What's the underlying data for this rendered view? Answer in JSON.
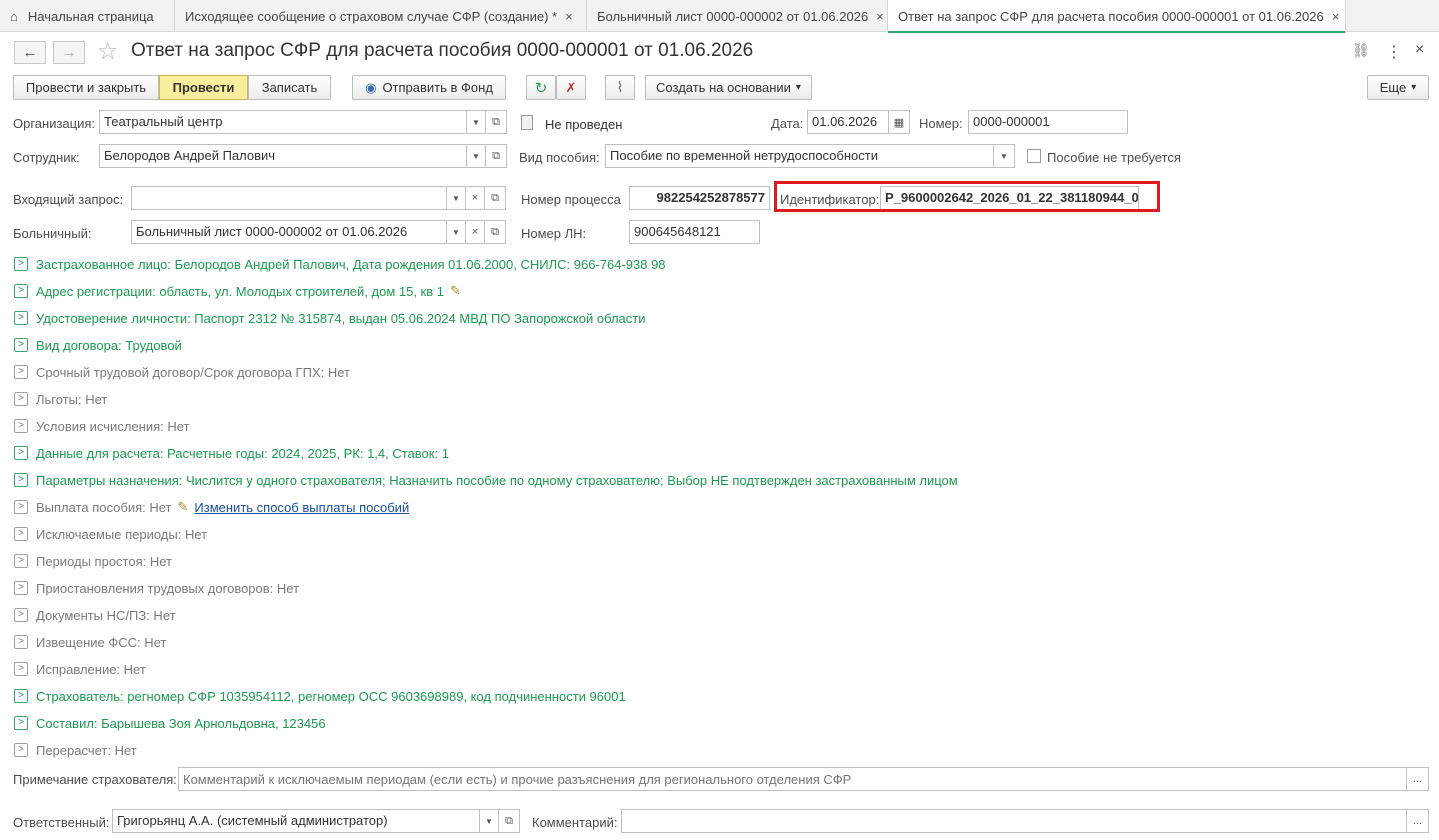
{
  "tabs": [
    {
      "label": "Начальная страница",
      "icon": "home-icon"
    },
    {
      "label": "Исходящее сообщение о страховом случае СФР (создание) *",
      "close": "×"
    },
    {
      "label": "Больничный лист 0000-000002 от 01.06.2026",
      "close": "×"
    },
    {
      "label": "Ответ на запрос СФР для расчета пособия 0000-000001 от 01.06.2026",
      "close": "×"
    }
  ],
  "window": {
    "title": "Ответ на запрос СФР для расчета пособия 0000-000001 от 01.06.2026",
    "back": "←",
    "forward": "→",
    "star": "☆",
    "link": "🔗",
    "more": "⋮",
    "close": "×"
  },
  "toolbar": {
    "post_close": "Провести и закрыть",
    "post": "Провести",
    "save": "Записать",
    "send_fund": "Отправить в Фонд",
    "create_based": "Создать на основании",
    "more": "Еще",
    "arrow": "▾"
  },
  "form": {
    "org_label": "Организация:",
    "org_value": "Театральный центр",
    "status": "Не проведен",
    "date_label": "Дата:",
    "date_value": "01.06.2026",
    "number_label": "Номер:",
    "number_value": "0000-000001",
    "employee_label": "Сотрудник:",
    "employee_value": "Белородов Андрей Палович",
    "benefit_type_label": "Вид пособия:",
    "benefit_type_value": "Пособие по временной нетрудоспособности",
    "not_required_label": "Пособие не требуется",
    "incoming_label": "Входящий запрос:",
    "incoming_value": "",
    "process_label": "Номер процесса",
    "process_value": "982254252878577",
    "id_label": "Идентификатор:",
    "id_value": "P_9600002642_2026_01_22_381180944_0:",
    "sick_label": "Больничный:",
    "sick_value": "Больничный лист 0000-000002 от 01.06.2026",
    "ln_label": "Номер ЛН:",
    "ln_value": "900645648121"
  },
  "sections": [
    {
      "text": "Застрахованное лицо: Белородов Андрей Палович, Дата рождения 01.06.2000, СНИЛС: 966-764-938 98",
      "state": "green"
    },
    {
      "text": "Адрес регистрации: область, ул. Молодых строителей, дом 15, кв 1",
      "state": "green",
      "pencil": true
    },
    {
      "text": "Удостоверение личности: Паспорт 2312 № 315874, выдан 05.06.2024 МВД ПО Запорожской области",
      "state": "green"
    },
    {
      "text": "Вид договора: Трудовой",
      "state": "green"
    },
    {
      "text": "Срочный трудовой договор/Срок договора ГПХ: Нет",
      "state": "gray"
    },
    {
      "text": "Льготы: Нет",
      "state": "gray"
    },
    {
      "text": "Условия исчисления: Нет",
      "state": "gray"
    },
    {
      "text": "Данные для расчета: Расчетные годы: 2024, 2025, РК: 1,4, Ставок: 1",
      "state": "green"
    },
    {
      "text": "Параметры назначения: Числится у одного страхователя; Назначить пособие по одному страхователю; Выбор НЕ подтвержден застрахованным лицом",
      "state": "green"
    },
    {
      "text": "Выплата пособия: Нет",
      "state": "gray",
      "pencil": true,
      "link": "Изменить способ выплаты пособий"
    },
    {
      "text": "Исключаемые периоды: Нет",
      "state": "gray"
    },
    {
      "text": "Периоды простоя: Нет",
      "state": "gray"
    },
    {
      "text": "Приостановления трудовых договоров: Нет",
      "state": "gray"
    },
    {
      "text": "Документы НС/ПЗ: Нет",
      "state": "gray"
    },
    {
      "text": "Извещение ФСС: Нет",
      "state": "gray"
    },
    {
      "text": "Исправление: Нет",
      "state": "gray"
    },
    {
      "text": "Страхователь: регномер СФР 1035954112, регномер ОСС 9603698989, код подчиненности 96001",
      "state": "green"
    },
    {
      "text": "Составил: Барышева Зоя Арнольдовна, 123456",
      "state": "green"
    },
    {
      "text": "Перерасчет: Нет",
      "state": "gray"
    }
  ],
  "footer": {
    "note_label": "Примечание страхователя:",
    "note_placeholder": "Комментарий к исключаемым периодам (если есть) и прочие разъяснения для регионального отделения СФР",
    "resp_label": "Ответственный:",
    "resp_value": "Григорьянц А.А. (системный администратор)",
    "comment_label": "Комментарий:",
    "comment_value": "",
    "ellipsis": "..."
  },
  "colors": {
    "accent_green": "#1c9a52",
    "primary_yellow": "#fbed9e",
    "highlight_red": "#e0181f"
  }
}
